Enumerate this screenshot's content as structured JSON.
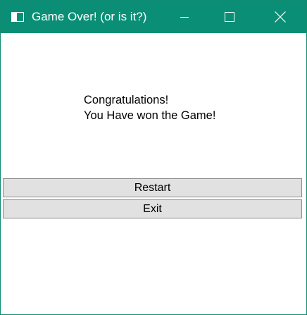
{
  "window": {
    "title": "Game Over! (or is it?)",
    "titlebar_color": "#0a8f76"
  },
  "titlebar_controls": {
    "minimize_icon": "minimize-icon",
    "maximize_icon": "maximize-icon",
    "close_icon": "close-icon"
  },
  "message": {
    "line1": "Congratulations!",
    "line2": "You Have won the Game!"
  },
  "buttons": {
    "restart_label": "Restart",
    "exit_label": "Exit"
  }
}
